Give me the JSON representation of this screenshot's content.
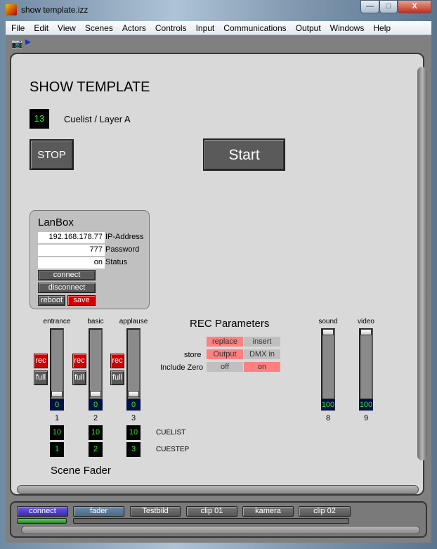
{
  "window": {
    "title": "show template.izz",
    "minimize": "—",
    "maximize": "□",
    "close": "X"
  },
  "menu": [
    "File",
    "Edit",
    "View",
    "Scenes",
    "Actors",
    "Controls",
    "Input",
    "Communications",
    "Output",
    "Windows",
    "Help"
  ],
  "toolbar": {
    "icons": [
      "camera-icon",
      "play-icon"
    ]
  },
  "main": {
    "title": "SHOW TEMPLATE",
    "layer_number": "13",
    "layer_label": "Cuelist / Layer A",
    "stop_label": "STOP",
    "start_label": "Start",
    "lanbox": {
      "title": "LanBox",
      "ip": "192.168.178.77",
      "ip_label": "IP-Address",
      "password": "777",
      "password_label": "Password",
      "status": "on",
      "status_label": "Status",
      "connect": "connect",
      "disconnect": "disconnect",
      "reboot": "reboot",
      "save": "save"
    },
    "faders": [
      {
        "name": "entrance",
        "value": "0",
        "level": 0,
        "number": "1",
        "cuelist": "10",
        "cuestep": "1"
      },
      {
        "name": "basic",
        "value": "0",
        "level": 0,
        "number": "2",
        "cuelist": "10",
        "cuestep": "2"
      },
      {
        "name": "applause",
        "value": "0",
        "level": 0,
        "number": "3",
        "cuelist": "10",
        "cuestep": "3"
      }
    ],
    "rec_label": "rec",
    "full_label": "full",
    "cuelist_label": "CUELIST",
    "cuestep_label": "CUESTEP",
    "scene_fader_label": "Scene Fader",
    "rec_params": {
      "title": "REC Parameters",
      "replace": "replace",
      "insert": "insert",
      "store_label": "store",
      "output": "Output",
      "dmx_in": "DMX in",
      "include_zero_label": "Include Zero",
      "off": "off",
      "on": "on",
      "active_color": "#ff8080",
      "inactive_color": "#c0c0c0"
    },
    "media_faders": [
      {
        "name": "sound",
        "value": "100",
        "level": 100,
        "number": "8"
      },
      {
        "name": "video",
        "value": "100",
        "level": 100,
        "number": "9"
      }
    ]
  },
  "bottom": {
    "buttons": [
      "connect",
      "fader",
      "Testbild",
      "clip 01",
      "kamera",
      "clip 02"
    ]
  }
}
